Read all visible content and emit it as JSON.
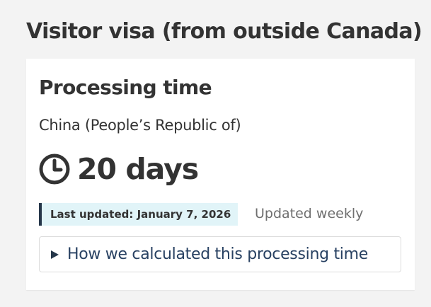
{
  "page": {
    "title": "Visitor visa (from outside Canada)"
  },
  "card": {
    "heading": "Processing time",
    "country": "China (People’s Republic of)",
    "time_icon": "clock-icon",
    "processing_time": "20 days",
    "last_updated": "Last updated: January 7, 2026",
    "update_frequency": "Updated weekly",
    "details_icon": "triangle-right-icon",
    "details_label": "How we calculated this processing time"
  },
  "colors": {
    "background": "#f3f3f3",
    "card_background": "#ffffff",
    "badge_background": "#e1f4f8",
    "badge_border": "#26374a",
    "link_text": "#284162",
    "muted_text": "#6f6f6f"
  }
}
